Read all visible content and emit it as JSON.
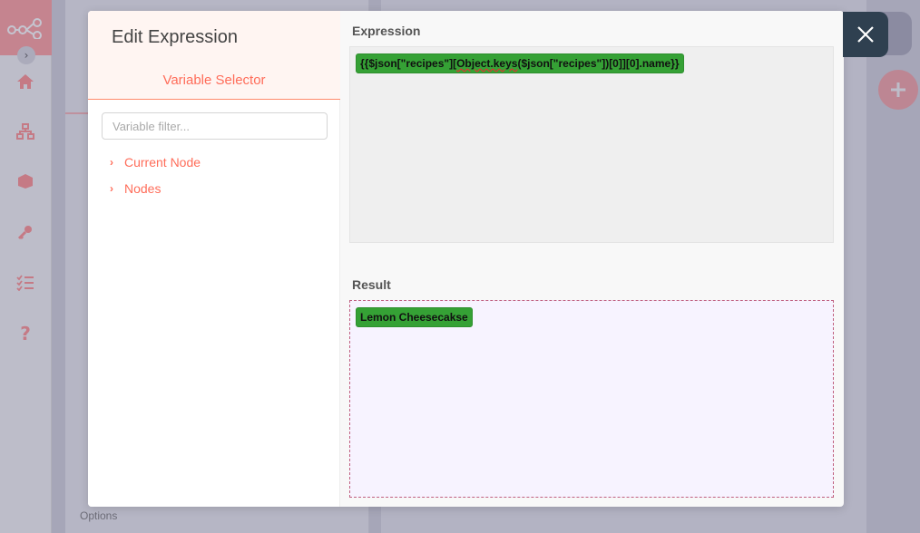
{
  "dialog": {
    "title": "Edit Expression",
    "variable_selector_title": "Variable Selector",
    "filter_placeholder": "Variable filter...",
    "tree": [
      {
        "label": "Current Node"
      },
      {
        "label": "Nodes"
      }
    ],
    "expression_label": "Expression",
    "expression": {
      "prefix": "{{$json[\"recipes\"][",
      "misspelled": "Object.keys",
      "suffix": "($json[\"recipes\"])[0]][0].name}}"
    },
    "result_label": "Result",
    "result_value": "Lemon Cheesecakse"
  },
  "background": {
    "options_label": "Options"
  },
  "icons": {
    "logo": "workflow-nodes-icon",
    "close": "close-icon",
    "add": "plus-icon"
  },
  "colors": {
    "accent": "#ff6d5a",
    "chip": "#35a135",
    "close_button": "#2f4050"
  }
}
